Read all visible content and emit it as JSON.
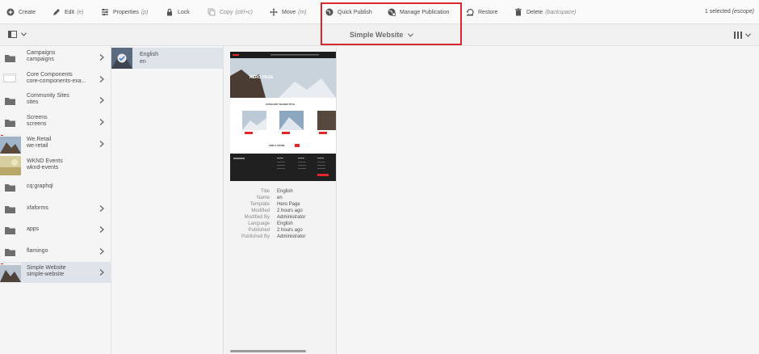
{
  "toolbar": {
    "create": "Create",
    "edit": "Edit",
    "edit_shortcut": "(e)",
    "properties": "Properties",
    "properties_shortcut": "(p)",
    "lock": "Lock",
    "copy": "Copy",
    "copy_shortcut": "(ctrl+c)",
    "move": "Move",
    "move_shortcut": "(m)",
    "quick_publish": "Quick Publish",
    "manage_publication": "Manage Publication",
    "restore": "Restore",
    "delete": "Delete",
    "delete_shortcut": "(backspace)",
    "selected": "1 selected",
    "selected_shortcut": "(escope)"
  },
  "header": {
    "title": "Simple Website"
  },
  "column1": [
    {
      "title": "Campaigns",
      "name": "campaigns"
    },
    {
      "title": "Core Components",
      "name": "core-components-exa..."
    },
    {
      "title": "Community Sites",
      "name": "sites"
    },
    {
      "title": "Screens",
      "name": "screens"
    },
    {
      "title": "We.Retail",
      "name": "we-retail"
    },
    {
      "title": "WKND Events",
      "name": "wknd-events"
    },
    {
      "title": "cq:graphql"
    },
    {
      "title": "xfaforms"
    },
    {
      "title": "apps"
    },
    {
      "title": "flamingo"
    },
    {
      "title": "Simple Website",
      "name": "simple-website"
    }
  ],
  "column2": {
    "title": "English",
    "name": "en"
  },
  "preview": {
    "hero_text": "HERO PAGE",
    "teaser_title": "CATEGORY TEASER TITLE",
    "find_store": "FIND A STORE"
  },
  "meta": [
    {
      "k": "Title",
      "v": "English"
    },
    {
      "k": "Name",
      "v": "en"
    },
    {
      "k": "Template",
      "v": "Hero Page"
    },
    {
      "k": "Modified",
      "v": "2 hours ago"
    },
    {
      "k": "Modified By",
      "v": "Administrator"
    },
    {
      "k": "Language",
      "v": "English"
    },
    {
      "k": "Published",
      "v": "2 hours ago"
    },
    {
      "k": "Published By",
      "v": "Administrator"
    }
  ],
  "colors": {
    "highlight": "#d7282f",
    "selected_row": "#dfe3ea",
    "brand_red": "#e3262d"
  }
}
